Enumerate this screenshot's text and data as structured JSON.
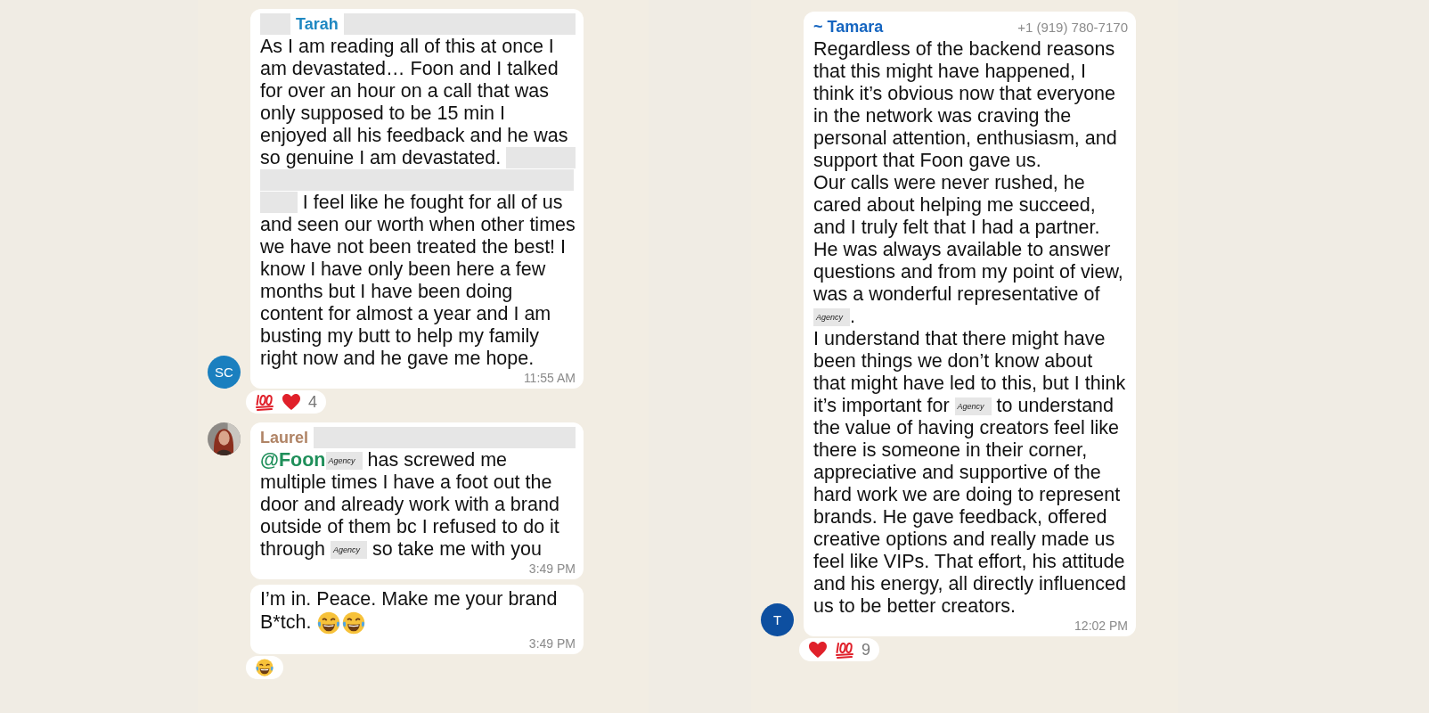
{
  "panels": [
    {
      "messages": [
        {
          "avatar": {
            "kind": "initials",
            "text": "SC",
            "color": "#1a7fbf"
          },
          "sender": {
            "name": "Tarah",
            "color": "#1f88c2",
            "redacted_before": true,
            "redacted_after": true
          },
          "body": [
            {
              "kind": "text",
              "text": "As I am reading all of this at once I am devastated… Foon and I talked for over an hour on a call that was only supposed to be 15 min I enjoyed all his feedback and he was so genuine I am devastated. "
            },
            {
              "kind": "redaction"
            },
            {
              "kind": "text",
              "text": " I feel like he fought for all of us and seen our worth when other times we have not been treated the best! I know I have only been here a few months but I have been doing content for almost a year and I am busting my butt to help my family right now and he gave me hope."
            }
          ],
          "time": "11:55 AM",
          "reactions": {
            "items": [
              {
                "kind": "hundred"
              },
              {
                "kind": "heart"
              }
            ],
            "count": "4"
          }
        },
        {
          "sender": {
            "name": "Laurel",
            "color": "#b08466",
            "redacted_after": true
          },
          "body": [
            {
              "kind": "mention",
              "text": "@Foon"
            },
            {
              "kind": "tag",
              "text": "Agency"
            },
            {
              "kind": "text",
              "text": " has screwed me multiple times I have a foot out the door and already work with a brand outside of them bc I refused to do it through "
            },
            {
              "kind": "tag",
              "text": "Agency"
            },
            {
              "kind": "text",
              "text": " so take me with you"
            }
          ],
          "time": "3:49 PM"
        },
        {
          "body": [
            {
              "kind": "text",
              "text": "I’m in. Peace. Make me your brand B*tch. "
            },
            {
              "kind": "laugh"
            },
            {
              "kind": "laugh"
            }
          ],
          "time": "3:49 PM",
          "reactions": {
            "items": [
              {
                "kind": "laugh"
              }
            ]
          }
        }
      ]
    },
    {
      "messages": [
        {
          "avatar": {
            "kind": "initials",
            "text": "T",
            "color": "#0d4fa0"
          },
          "sender": {
            "name": "~ Tamara",
            "color": "#1565c0",
            "phone": "+1 (919) 780-7170"
          },
          "body": [
            {
              "kind": "text",
              "text": "Regardless of the backend reasons that this might have happened, I think it’s obvious now that everyone in the network was craving the personal attention, enthusiasm, and support that Foon gave us.\nOur calls were never rushed, he cared about helping me succeed, and I truly felt that I had a partner. He was always available to answer questions and from my point of view, was a wonderful representative of "
            },
            {
              "kind": "tag",
              "text": "Agency"
            },
            {
              "kind": "text",
              "text": ".\nI understand that there might have been things we don’t know about that might have led to this, but I think it’s important for "
            },
            {
              "kind": "tag",
              "text": "Agency"
            },
            {
              "kind": "text",
              "text": " to understand the value of having creators feel like there is someone in their corner, appreciative and supportive of the hard work we are doing to represent brands. He gave feedback, offered creative options and really made us feel like VIPs. That effort, his attitude and his energy, all directly influenced us to be better creators."
            }
          ],
          "time": "12:02 PM",
          "reactions": {
            "items": [
              {
                "kind": "heart"
              },
              {
                "kind": "hundred"
              }
            ],
            "count": "9"
          }
        }
      ]
    }
  ]
}
